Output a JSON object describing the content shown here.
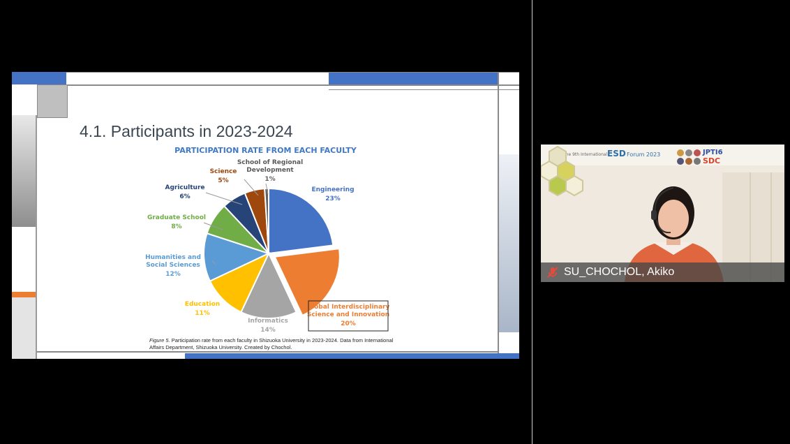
{
  "slide": {
    "title": "4.1. Participants in 2023-2024",
    "caption_figure": "Figure 5.",
    "caption_text": " Participation rate from each faculty in Shizuoka University in 2023-2024. Data from International Affairs Department, Shizuoka University. Created by Chochol."
  },
  "chart_data": {
    "type": "pie",
    "title": "PARTICIPATION RATE FROM EACH FACULTY",
    "slices": [
      {
        "label": [
          "Engineering"
        ],
        "value": 23,
        "percent_label": "23%",
        "color": "#4472c4"
      },
      {
        "label": [
          "Global Interdisciplinary",
          "Science and Innovation"
        ],
        "value": 20,
        "percent_label": "20%",
        "color": "#ed7d31"
      },
      {
        "label": [
          "Informatics"
        ],
        "value": 14,
        "percent_label": "14%",
        "color": "#a5a5a5"
      },
      {
        "label": [
          "Education"
        ],
        "value": 11,
        "percent_label": "11%",
        "color": "#ffc000"
      },
      {
        "label": [
          "Humanities and",
          "Social Sciences"
        ],
        "value": 12,
        "percent_label": "12%",
        "color": "#5b9bd5"
      },
      {
        "label": [
          "Graduate School"
        ],
        "value": 8,
        "percent_label": "8%",
        "color": "#70ad47"
      },
      {
        "label": [
          "Agriculture"
        ],
        "value": 6,
        "percent_label": "6%",
        "color": "#264478"
      },
      {
        "label": [
          "Science"
        ],
        "value": 5,
        "percent_label": "5%",
        "color": "#9e480e"
      },
      {
        "label": [
          "School of Regional",
          "Development"
        ],
        "value": 1,
        "percent_label": "1%",
        "color": "#636363"
      }
    ]
  },
  "video": {
    "participant_name": "SU_CHOCHOL, Akiko",
    "banner_text": "The 9th International ESD Forum 2023",
    "logo_text": "JPTI6 SDC",
    "mic_icon": "mic-muted-icon"
  }
}
